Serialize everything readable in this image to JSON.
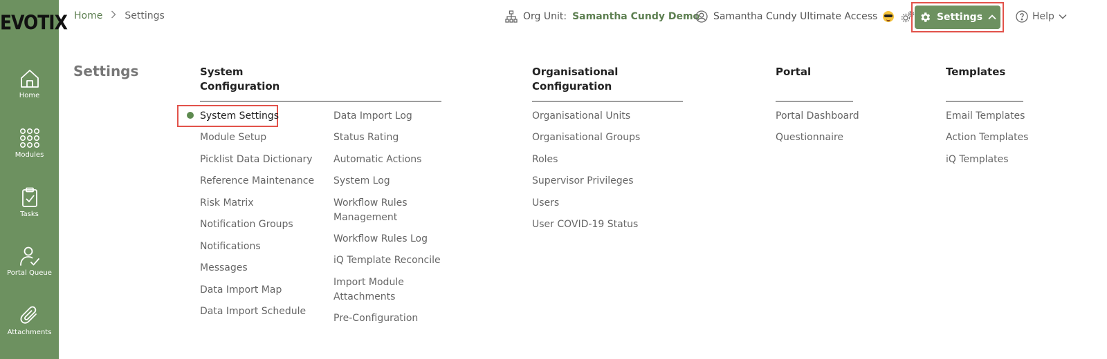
{
  "app": {
    "logo": "EVOTIX"
  },
  "sidebar": {
    "items": [
      {
        "label": "Home",
        "icon": "home-icon"
      },
      {
        "label": "Modules",
        "icon": "grid-icon"
      },
      {
        "label": "Tasks",
        "icon": "clipboard-check-icon"
      },
      {
        "label": "Portal Queue",
        "icon": "user-check-icon"
      },
      {
        "label": "Attachments",
        "icon": "paperclip-icon"
      }
    ]
  },
  "header": {
    "breadcrumb": {
      "home": "Home",
      "current": "Settings"
    },
    "org_unit": {
      "label": "Org Unit:",
      "value": "Samantha Cundy Demo"
    },
    "user": {
      "name": "Samantha Cundy Ultimate Access"
    },
    "settings_label": "Settings",
    "help_label": "Help"
  },
  "page": {
    "title": "Settings"
  },
  "groups": {
    "system": {
      "title_line1": "System",
      "title_line2": "Configuration",
      "col1": [
        "System Settings",
        "Module Setup",
        "Picklist Data Dictionary",
        "Reference Maintenance",
        "Risk Matrix",
        "Notification Groups",
        "Notifications",
        "Messages",
        "Data Import Map",
        "Data Import Schedule"
      ],
      "col2": [
        "Data Import Log",
        "Status Rating",
        "Automatic Actions",
        "System Log",
        "Workflow Rules Management",
        "Workflow Rules Log",
        "iQ Template Reconcile",
        "Import Module Attachments",
        "Pre-Configuration"
      ]
    },
    "organisational": {
      "title_line1": "Organisational",
      "title_line2": "Configuration",
      "items": [
        "Organisational Units",
        "Organisational Groups",
        "Roles",
        "Supervisor Privileges",
        "Users",
        "User COVID-19 Status"
      ]
    },
    "portal": {
      "title": "Portal",
      "items": [
        "Portal Dashboard",
        "Questionnaire"
      ]
    },
    "templates": {
      "title": "Templates",
      "items": [
        "Email Templates",
        "Action Templates",
        "iQ Templates"
      ]
    }
  },
  "colors": {
    "brand": "#6d9160",
    "brand_text": "#5d7f51",
    "highlight": "#e2524a"
  }
}
